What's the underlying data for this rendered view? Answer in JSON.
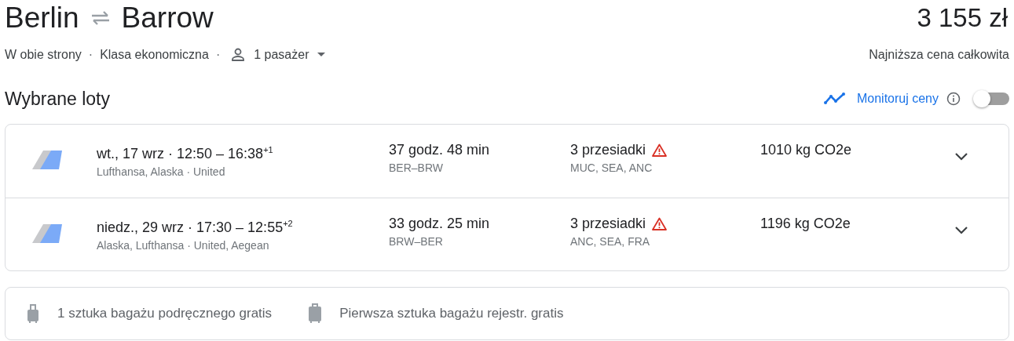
{
  "header": {
    "origin": "Berlin",
    "destination": "Barrow",
    "price": "3 155 zł",
    "trip_type": "W obie strony",
    "separators": [
      "·",
      "·"
    ],
    "cabin": "Klasa ekonomiczna",
    "passengers": "1 pasażer",
    "price_note": "Najniższa cena całkowita"
  },
  "section": {
    "title": "Wybrane loty",
    "monitor_label": "Monitoruj ceny",
    "monitor_on": false
  },
  "flights": [
    {
      "schedule": "wt., 17 wrz · 12:50 – 16:38$^{+1}$",
      "airlines": "Lufthansa, Alaska · United",
      "duration": "37 godz. 48 min",
      "route": "BER–BRW",
      "stops": "3 przesiadki",
      "stop_airports": "MUC, SEA, ANC",
      "warning": true,
      "emissions": "1010 kg CO2e"
    },
    {
      "schedule": "niedz., 29 wrz · 17:30 – 12:55$^{+2}$",
      "airlines": "Alaska, Lufthansa · United, Aegean",
      "duration": "33 godz. 25 min",
      "route": "BRW–BER",
      "stops": "3 przesiadki",
      "stop_airports": "ANC, SEA, FRA",
      "warning": true,
      "emissions": "1196 kg CO2e"
    }
  ],
  "baggage": [
    {
      "kind": "carry-on",
      "text": "1 sztuka bagażu podręcznego gratis"
    },
    {
      "kind": "checked",
      "text": "Pierwsza sztuka bagażu rejestr. gratis"
    }
  ]
}
